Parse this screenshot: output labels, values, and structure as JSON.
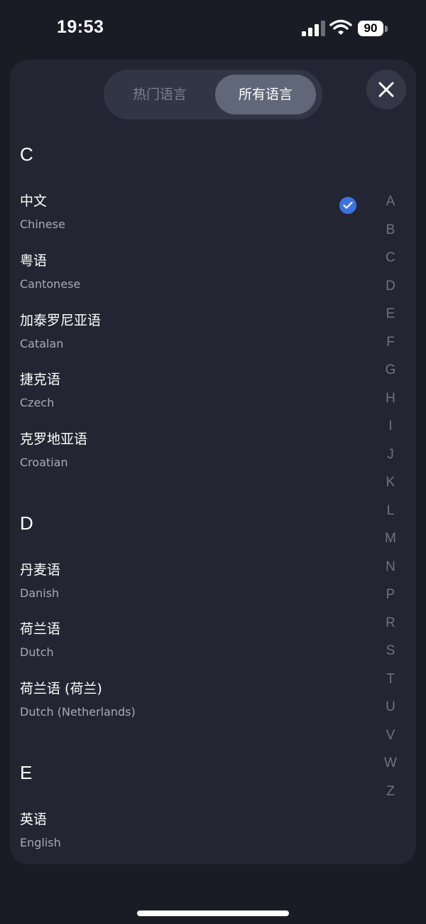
{
  "status_bar": {
    "time": "19:53",
    "battery": "90"
  },
  "tabs": {
    "popular": "热门语言",
    "all": "所有语言"
  },
  "sections": [
    {
      "letter": "C",
      "items": [
        {
          "native": "中文",
          "english": "Chinese",
          "selected": true
        },
        {
          "native": "粤语",
          "english": "Cantonese"
        },
        {
          "native": "加泰罗尼亚语",
          "english": "Catalan"
        },
        {
          "native": "捷克语",
          "english": "Czech"
        },
        {
          "native": "克罗地亚语",
          "english": "Croatian"
        }
      ]
    },
    {
      "letter": "D",
      "items": [
        {
          "native": "丹麦语",
          "english": "Danish"
        },
        {
          "native": "荷兰语",
          "english": "Dutch"
        },
        {
          "native": "荷兰语 (荷兰)",
          "english": "Dutch (Netherlands)"
        }
      ]
    },
    {
      "letter": "E",
      "items": [
        {
          "native": "英语",
          "english": "English"
        }
      ]
    }
  ],
  "index_letters": [
    "A",
    "B",
    "C",
    "D",
    "E",
    "F",
    "G",
    "H",
    "I",
    "J",
    "K",
    "L",
    "M",
    "N",
    "P",
    "R",
    "S",
    "T",
    "U",
    "V",
    "W",
    "Z"
  ],
  "colors": {
    "accent": "#3d72e0",
    "sheet": "#232632",
    "background": "#1a1c25"
  }
}
